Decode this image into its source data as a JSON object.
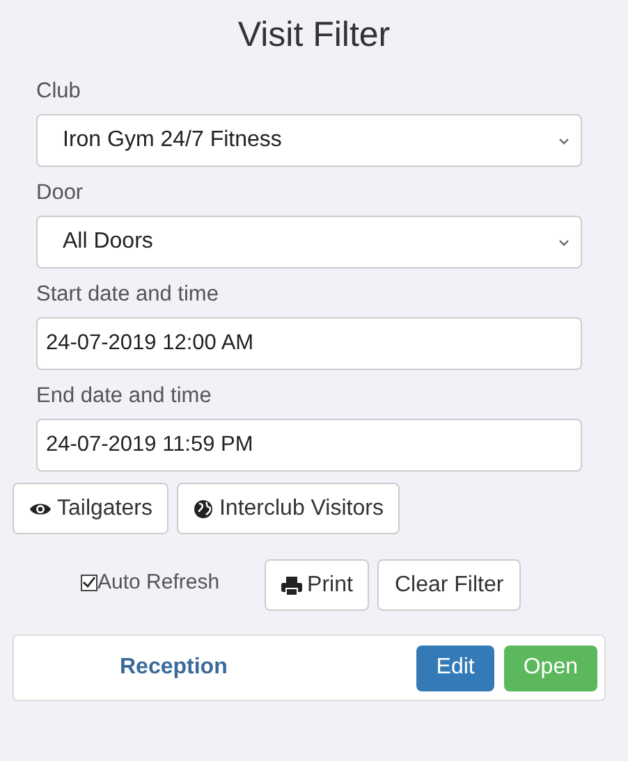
{
  "title": "Visit Filter",
  "fields": [
    {
      "label": "Club",
      "kind": "select",
      "value": "Iron Gym 24/7 Fitness"
    },
    {
      "label": "Door",
      "kind": "select",
      "value": "All Doors"
    },
    {
      "label": "Start date and time",
      "kind": "input",
      "value": "24-07-2019 12:00 AM"
    },
    {
      "label": "End date and time",
      "kind": "input",
      "value": "24-07-2019 11:59 PM"
    }
  ],
  "filter_buttons": [
    {
      "label": "Tailgaters",
      "kind": "eye"
    },
    {
      "label": "Interclub Visitors",
      "kind": "globe"
    }
  ],
  "auto_refresh": {
    "label": "Auto Refresh",
    "checked": true
  },
  "action_buttons": [
    {
      "label": "Print",
      "kind": "print"
    },
    {
      "label": "Clear Filter",
      "kind": "plain"
    }
  ],
  "door_panel": {
    "name": "Reception",
    "buttons": [
      {
        "label": "Edit",
        "kind": "primary"
      },
      {
        "label": "Open",
        "kind": "success"
      }
    ]
  }
}
